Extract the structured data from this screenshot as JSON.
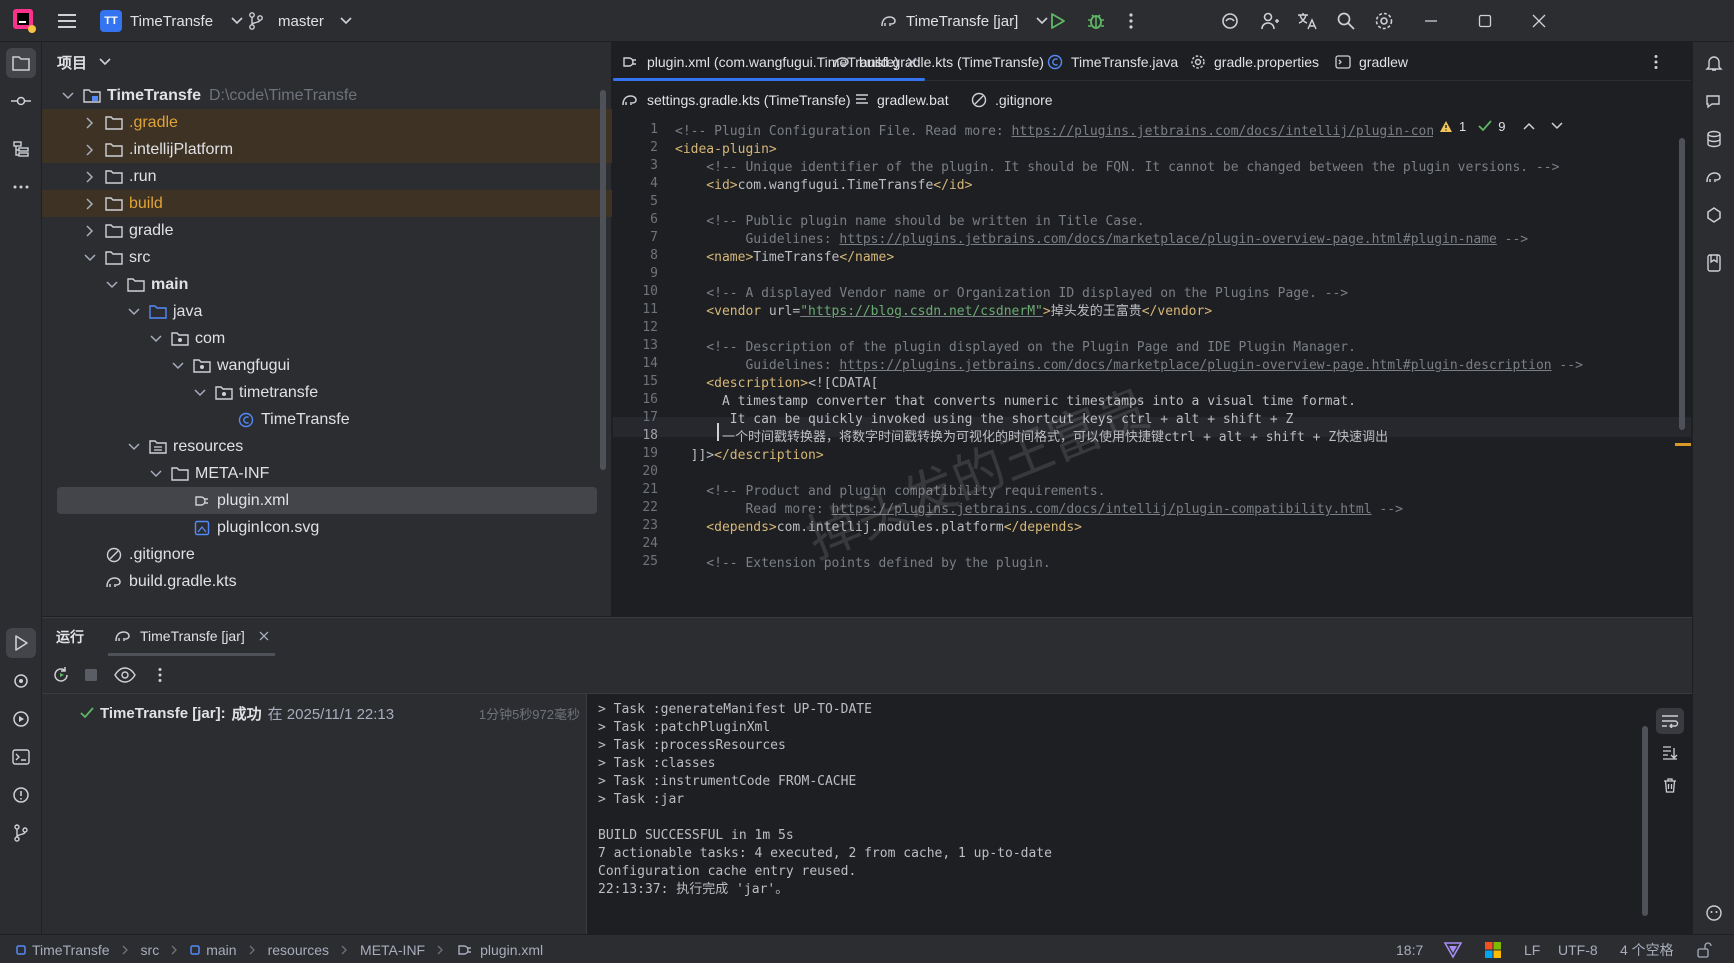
{
  "titlebar": {
    "project_initials": "TT",
    "project_name": "TimeTransfe",
    "branch": "master",
    "run_config": "TimeTransfe [jar]"
  },
  "project_panel": {
    "title": "项目",
    "tree": [
      {
        "label": "TimeTransfe",
        "path": "D:\\code\\TimeTransfe",
        "icon": "module-folder-icon"
      },
      {
        "label": ".gradle",
        "icon": "folder-icon"
      },
      {
        "label": ".intellijPlatform",
        "icon": "folder-icon"
      },
      {
        "label": ".run",
        "icon": "folder-icon"
      },
      {
        "label": "build",
        "icon": "folder-icon"
      },
      {
        "label": "gradle",
        "icon": "folder-icon"
      },
      {
        "label": "src",
        "icon": "folder-icon"
      },
      {
        "label": "main",
        "icon": "folder-icon"
      },
      {
        "label": "java",
        "icon": "source-folder-icon"
      },
      {
        "label": "com",
        "icon": "package-icon"
      },
      {
        "label": "wangfugui",
        "icon": "package-icon"
      },
      {
        "label": "timetransfe",
        "icon": "package-icon"
      },
      {
        "label": "TimeTransfe",
        "icon": "class-icon"
      },
      {
        "label": "resources",
        "icon": "resources-folder-icon"
      },
      {
        "label": "META-INF",
        "icon": "folder-icon"
      },
      {
        "label": "plugin.xml",
        "icon": "plugin-xml-icon"
      },
      {
        "label": "pluginIcon.svg",
        "icon": "svg-file-icon"
      },
      {
        "label": ".gitignore",
        "icon": "ignore-file-icon"
      },
      {
        "label": "build.gradle.kts",
        "icon": "gradle-file-icon"
      }
    ]
  },
  "editor": {
    "tabs_row1": [
      {
        "label": "plugin.xml (com.wangfugui.TimeTransfe)",
        "icon": "plugin-xml-icon"
      },
      {
        "label": "build.gradle.kts (TimeTransfe)",
        "icon": "gradle-file-icon"
      },
      {
        "label": "TimeTransfe.java",
        "icon": "class-icon"
      },
      {
        "label": "gradle.properties",
        "icon": "gear-icon"
      },
      {
        "label": "gradlew",
        "icon": "terminal-file-icon"
      }
    ],
    "tabs_row2": [
      {
        "label": "settings.gradle.kts (TimeTransfe)",
        "icon": "gradle-file-icon"
      },
      {
        "label": "gradlew.bat",
        "icon": "text-file-icon"
      },
      {
        "label": ".gitignore",
        "icon": "ignore-file-icon"
      }
    ],
    "warnings": "1",
    "checks": "9",
    "line_numbers": [
      "1",
      "2",
      "3",
      "4",
      "5",
      "6",
      "7",
      "8",
      "9",
      "10",
      "11",
      "12",
      "13",
      "14",
      "15",
      "16",
      "17",
      "18",
      "19",
      "20",
      "21",
      "22",
      "23",
      "24",
      "25"
    ],
    "code": {
      "l1a": "<!-- Plugin Configuration File. Read more: ",
      "l1b": "https://plugins.jetbrains.com/docs/intellij/plugin-configuration-fi",
      "l2": "<idea-plugin>",
      "l3": "    <!-- Unique identifier of the plugin. It should be FQN. It cannot be changed between the plugin versions. -->",
      "l4a": "    <id>",
      "l4b": "com.wangfugui.TimeTransfe",
      "l4c": "</id>",
      "l6": "    <!-- Public plugin name should be written in Title Case.",
      "l7a": "         Guidelines: ",
      "l7b": "https://plugins.jetbrains.com/docs/marketplace/plugin-overview-page.html#plugin-name",
      "l7c": " -->",
      "l8a": "    <name>",
      "l8b": "TimeTransfe",
      "l8c": "</name>",
      "l10": "    <!-- A displayed Vendor name or Organization ID displayed on the Plugins Page. -->",
      "l11a": "    <vendor ",
      "l11b": "url=",
      "l11c": "\"https://blog.csdn.net/csdnerM\"",
      "l11d": ">",
      "l11e": "掉头发的王富贵",
      "l11f": "</vendor>",
      "l13": "    <!-- Description of the plugin displayed on the Plugin Page and IDE Plugin Manager.",
      "l14a": "         Guidelines: ",
      "l14b": "https://plugins.jetbrains.com/docs/marketplace/plugin-overview-page.html#plugin-description",
      "l14c": " -->",
      "l15a": "    <description>",
      "l15b": "<![CDATA[",
      "l16": "      A timestamp converter that converts numeric timestamps into a visual time format.",
      "l17": "       It can be quickly invoked using the shortcut keys ctrl + alt + shift + Z",
      "l18": "      一个时间戳转换器，将数字时间戳转换为可视化的时间格式，可以使用快捷键ctrl + alt + shift + Z快速调出",
      "l19a": "  ]]>",
      "l19b": "</description>",
      "l21": "    <!-- Product and plugin compatibility requirements.",
      "l22a": "         Read more: ",
      "l22b": "https://plugins.jetbrains.com/docs/intellij/plugin-compatibility.html",
      "l22c": " -->",
      "l23a": "    <depends>",
      "l23b": "com.intellij.modules.platform",
      "l23c": "</depends>",
      "l25": "    <!-- Extension points defined by the plugin."
    },
    "watermark": "掉头发的王富贵"
  },
  "run_panel": {
    "tab_run": "运行",
    "tab_config": "TimeTransfe [jar]",
    "result_name": "TimeTransfe [jar]:",
    "result_status": "成功",
    "result_time": "在 2025/11/1 22:13",
    "result_duration": "1分钟5秒972毫秒",
    "console": [
      "> Task :generateManifest UP-TO-DATE",
      "> Task :patchPluginXml",
      "> Task :processResources",
      "> Task :classes",
      "> Task :instrumentCode FROM-CACHE",
      "> Task :jar",
      "",
      "BUILD SUCCESSFUL in 1m 5s",
      "7 actionable tasks: 4 executed, 2 from cache, 1 up-to-date",
      "Configuration cache entry reused.",
      "22:13:37: 执行完成 'jar'。"
    ]
  },
  "statusbar": {
    "breadcrumbs": [
      "TimeTransfe",
      "src",
      "main",
      "resources",
      "META-INF",
      "plugin.xml"
    ],
    "position": "18:7",
    "line_sep": "LF",
    "encoding": "UTF-8",
    "indent": "4 个空格"
  },
  "colors": {
    "accent": "#3574f0",
    "success": "#5fb865",
    "folder_excluded": "#e1a336"
  }
}
